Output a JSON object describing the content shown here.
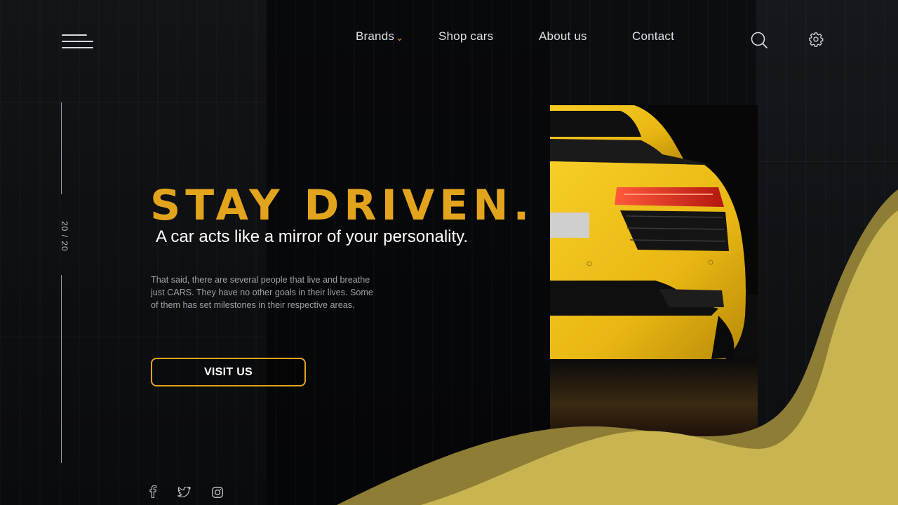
{
  "nav": {
    "items": [
      {
        "label": "Brands",
        "has_dropdown": true
      },
      {
        "label": "Shop cars"
      },
      {
        "label": "About us"
      },
      {
        "label": "Contact"
      }
    ]
  },
  "header_icons": [
    "hamburger-menu-icon",
    "search-icon",
    "gear-icon"
  ],
  "slide_counter": "20 / 20",
  "hero": {
    "headline": "STAY DRIVEN.",
    "subheadline": "A car acts like a mirror of your personality.",
    "paragraph": "That said, there are several people that live and breathe just CARS. They have no other goals in their lives. Some of them has set milestones in their respective areas.",
    "cta_label": "VISIT US"
  },
  "social_icons": [
    "facebook-icon",
    "twitter-icon",
    "instagram-icon"
  ],
  "colors": {
    "background": "#0b0d10",
    "accent": "#e3a41d",
    "car_yellow": "#f2c01c",
    "wave_light": "#c9b451",
    "wave_dark": "#8e7d34"
  }
}
